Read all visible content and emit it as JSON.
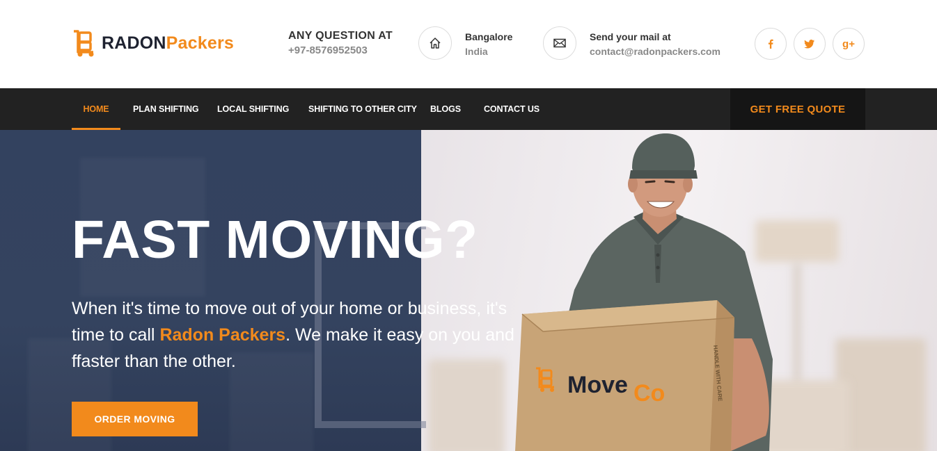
{
  "header": {
    "logo": {
      "part1": "RADON",
      "part2": "Packers"
    },
    "question": {
      "title": "ANY QUESTION AT",
      "phone": "+97-8576952503"
    },
    "location": {
      "city": "Bangalore",
      "country": "India"
    },
    "mail": {
      "title": "Send your mail at",
      "address": "contact@radonpackers.com"
    },
    "social": {
      "google_plus": "g+"
    }
  },
  "nav": {
    "items": [
      {
        "label": "HOME",
        "active": true
      },
      {
        "label": "PLAN SHIFTING",
        "active": false
      },
      {
        "label": "LOCAL SHIFTING",
        "active": false
      },
      {
        "label": "SHIFTING TO OTHER CITY",
        "active": false
      },
      {
        "label": "BLOGS",
        "active": false
      },
      {
        "label": "CONTACT US",
        "active": false
      }
    ],
    "cta": "GET FREE QUOTE"
  },
  "hero": {
    "title": "FAST MOVING?",
    "text_before": "When it's time to move out of your home or business, it's time to call ",
    "brand": "Radon Packers",
    "text_after": ". We make it easy on you and ffaster than the other.",
    "button": "ORDER MOVING",
    "box_label_part1": "Move",
    "box_label_part2": "Co",
    "box_side_text": "HANDLE WITH CARE"
  },
  "colors": {
    "accent": "#f28a1c",
    "nav_bg": "#222222",
    "hero_panel": "#33425f"
  }
}
